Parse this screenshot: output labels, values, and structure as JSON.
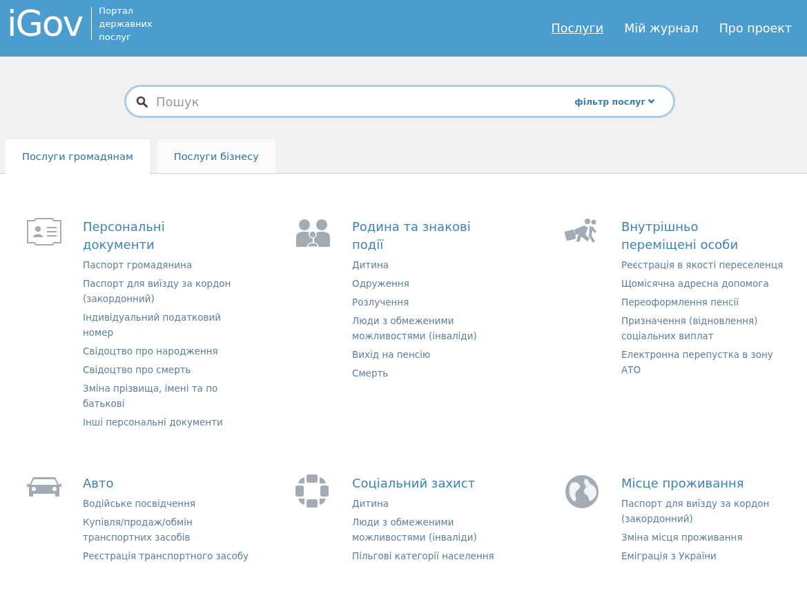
{
  "header": {
    "logo": "iGov",
    "tagline": "Портал державних послуг",
    "nav": [
      {
        "label": "Послуги",
        "selected": true
      },
      {
        "label": "Мій журнал",
        "selected": false
      },
      {
        "label": "Про проект",
        "selected": false
      }
    ]
  },
  "search": {
    "placeholder": "Пошук",
    "filter": "фільтр послуг"
  },
  "tabs": [
    {
      "label": "Послуги громадянам",
      "selected": true
    },
    {
      "label": "Послуги бізнесу",
      "selected": false
    }
  ],
  "categories": [
    {
      "title": "Персональні документи",
      "links": [
        "Паспорт громадянина",
        "Паспорт для виїзду за кордон (закордонний)",
        "Індивідуальний податковий номер",
        "Свідоцтво про народження",
        "Свідоцтво про смерть",
        "Зміна прізвища, імені та по батькові",
        "Інші персональні документи"
      ]
    },
    {
      "title": "Родина та знакові події",
      "links": [
        "Дитина",
        "Одруження",
        "Розлучення",
        "Люди з обмеженими можливостями (інваліди)",
        "Вихід на пенсію",
        "Смерть"
      ]
    },
    {
      "title": "Внутрішньо переміщені особи",
      "links": [
        "Реєстрація в якості переселенця",
        "Щомісячна адресна допомога",
        "Переоформлення пенсії",
        "Призначення (відновлення) соціальних виплат",
        "Електронна перепустка в зону АТО"
      ]
    },
    {
      "title": "Авто",
      "links": [
        "Водійське посвідчення",
        "Купівля/продаж/обмін транспортних засобів",
        "Реєстрація транспортного засобу"
      ]
    },
    {
      "title": "Соціальний захист",
      "links": [
        "Дитина",
        "Люди з обмеженими можливостями (інваліди)",
        "Пільгові категорії населення"
      ]
    },
    {
      "title": "Місце проживання",
      "links": [
        "Паспорт для виїзду за кордон (закордонний)",
        "Зміна місця проживання",
        "Еміграція з України"
      ]
    }
  ]
}
